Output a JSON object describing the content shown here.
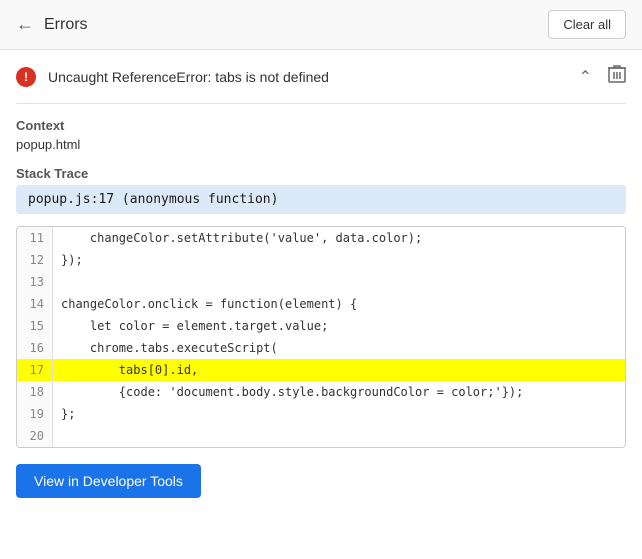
{
  "header": {
    "back_label": "←",
    "title": "Errors",
    "clear_all_label": "Clear all"
  },
  "error": {
    "icon_label": "!",
    "message": "Uncaught ReferenceError: tabs is not defined"
  },
  "context": {
    "label": "Context",
    "value": "popup.html"
  },
  "stack_trace": {
    "label": "Stack Trace",
    "entry": "popup.js:17 (anonymous function)"
  },
  "code_lines": [
    {
      "number": "11",
      "content": "    changeColor.setAttribute('value', data.color);",
      "highlighted": false
    },
    {
      "number": "12",
      "content": "});",
      "highlighted": false
    },
    {
      "number": "13",
      "content": "",
      "highlighted": false
    },
    {
      "number": "14",
      "content": "changeColor.onclick = function(element) {",
      "highlighted": false
    },
    {
      "number": "15",
      "content": "    let color = element.target.value;",
      "highlighted": false
    },
    {
      "number": "16",
      "content": "    chrome.tabs.executeScript(",
      "highlighted": false
    },
    {
      "number": "17",
      "content": "        tabs[0].id,",
      "highlighted": true
    },
    {
      "number": "18",
      "content": "        {code: 'document.body.style.backgroundColor = color;'});",
      "highlighted": false
    },
    {
      "number": "19",
      "content": "};",
      "highlighted": false
    },
    {
      "number": "20",
      "content": "",
      "highlighted": false
    }
  ],
  "dev_tools_button": {
    "label": "View in Developer Tools"
  }
}
